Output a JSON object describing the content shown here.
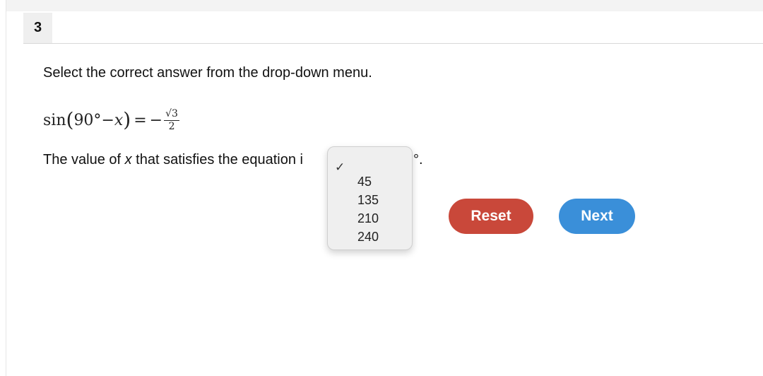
{
  "question": {
    "number": "3",
    "instruction": "Select the correct answer from the drop-down menu.",
    "equation": {
      "lhs_func": "sin",
      "lhs_angle": "90°",
      "lhs_minus": "−",
      "lhs_var": "x",
      "equals": "=",
      "rhs_sign": "−",
      "rhs_numerator": "√3",
      "rhs_denominator": "2"
    },
    "sentence_before": "The value of ",
    "sentence_var": "x",
    "sentence_after": " that satisfies the equation i",
    "sentence_tail": "°."
  },
  "dropdown": {
    "selected_marker": "✓",
    "options": [
      "45",
      "135",
      "210",
      "240"
    ]
  },
  "buttons": {
    "reset_label": "Reset",
    "next_label": "Next"
  },
  "colors": {
    "reset": "#c9483a",
    "next": "#3a8fd9"
  }
}
